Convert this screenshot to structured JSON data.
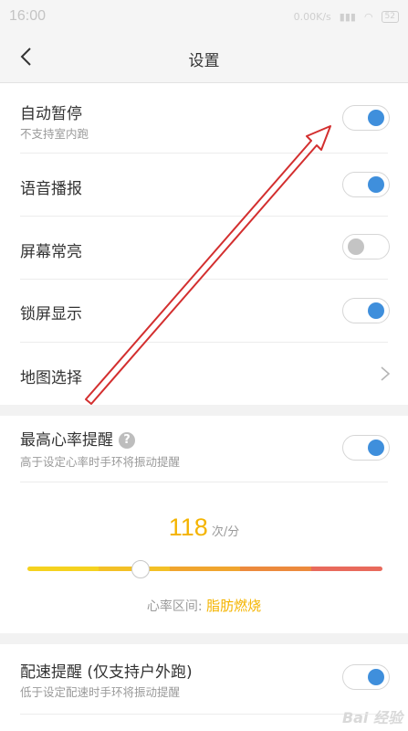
{
  "status_bar": {
    "time": "16:00",
    "icons_text": "0.00K/s",
    "battery": "52"
  },
  "header": {
    "title": "设置"
  },
  "settings": {
    "auto_pause": {
      "label": "自动暂停",
      "sub": "不支持室内跑",
      "on": true
    },
    "voice": {
      "label": "语音播报",
      "on": true
    },
    "screen_on": {
      "label": "屏幕常亮",
      "on": false
    },
    "lock_display": {
      "label": "锁屏显示",
      "on": true
    },
    "map_select": {
      "label": "地图选择"
    }
  },
  "heart_rate": {
    "label": "最高心率提醒",
    "help": "?",
    "sub": "高于设定心率时手环将振动提醒",
    "on": true,
    "value": "118",
    "unit": "次/分",
    "zone_label": "心率区间:",
    "zone_value": "脂肪燃烧",
    "slider_fraction": 0.32
  },
  "pace": {
    "label": "配速提醒 (仅支持户外跑)",
    "sub": "低于设定配速时手环将振动提醒",
    "on": true
  },
  "watermark": "Bai 经验",
  "colors": {
    "toggle_on": "#3f8fdc",
    "toggle_off": "#c4c4c4",
    "accent_value": "#f4b400",
    "arrow": "#d32f2f",
    "slider_segments": [
      "#f5d21f",
      "#f3c026",
      "#f0a52e",
      "#ec8a3d",
      "#e86a5c"
    ]
  }
}
